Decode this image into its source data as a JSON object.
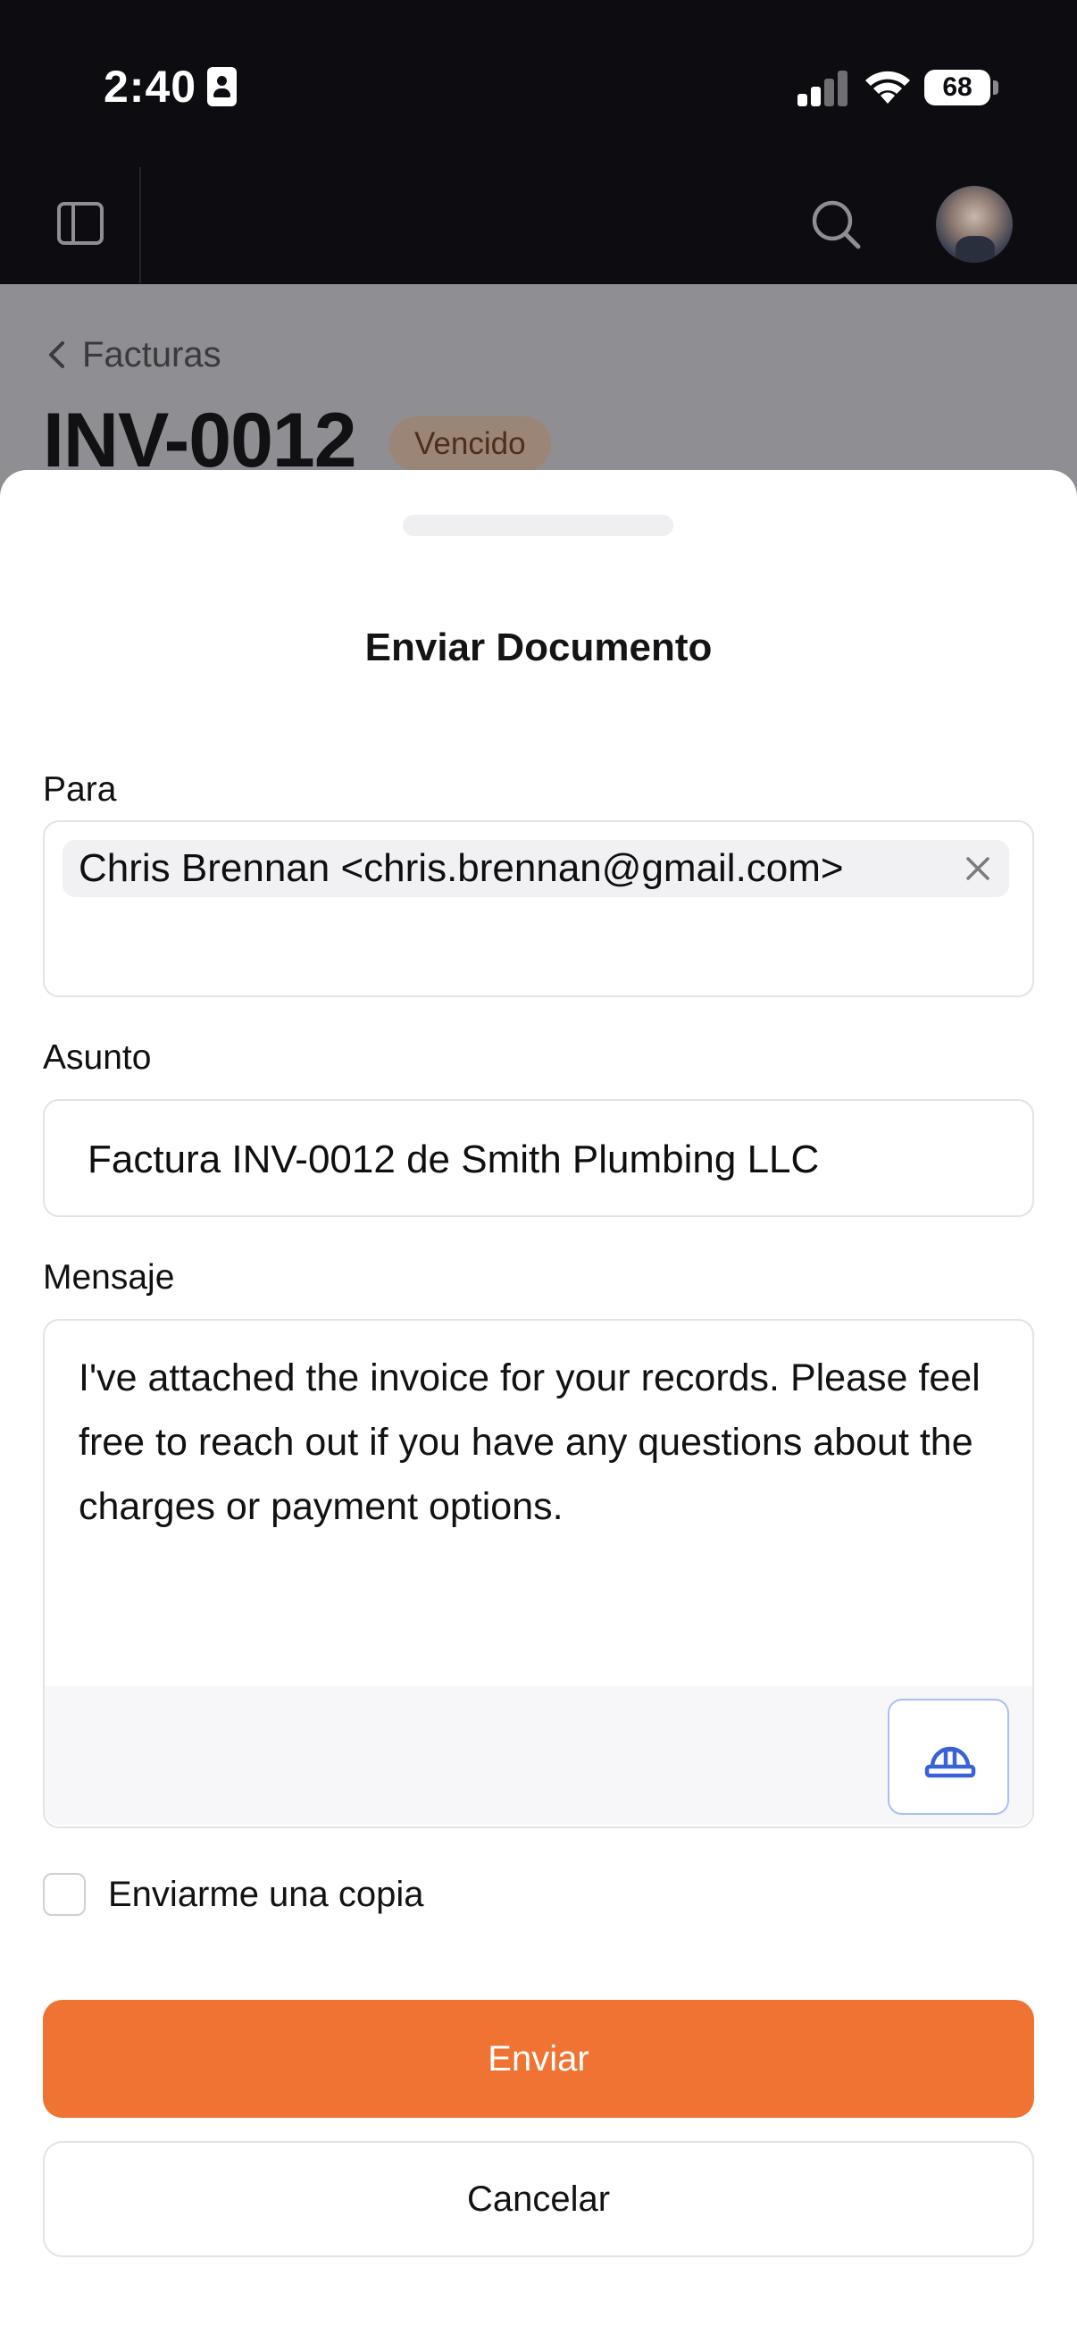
{
  "status_bar": {
    "time": "2:40",
    "battery": "68"
  },
  "header": {
    "sidebar_icon": "sidebar-toggle-icon",
    "search_icon": "search-icon"
  },
  "background_page": {
    "breadcrumb": "Facturas",
    "title": "INV-0012",
    "badge": "Vencido"
  },
  "sheet": {
    "title": "Enviar Documento",
    "to": {
      "label": "Para",
      "recipient": "Chris Brennan <chris.brennan@gmail.com>"
    },
    "subject": {
      "label": "Asunto",
      "value": "Factura INV-0012 de Smith Plumbing LLC"
    },
    "message": {
      "label": "Mensaje",
      "value": "I've attached the invoice for your records. Please feel free to reach out if you have any questions about the charges or payment options.",
      "tool_icon": "hard-hat-icon"
    },
    "copy_me": {
      "label": "Enviarme una copia",
      "checked": false
    },
    "send_label": "Enviar",
    "cancel_label": "Cancelar"
  },
  "colors": {
    "accent": "#ef7332",
    "badge_bg": "#9b8577",
    "badge_text": "#4d2f1a",
    "helmet_blue": "#3a62d7"
  }
}
